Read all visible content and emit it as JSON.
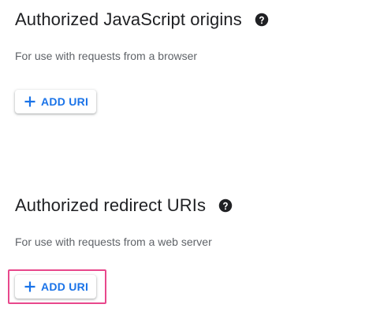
{
  "js_origins": {
    "title": "Authorized JavaScript origins",
    "help_icon": "help-circle-icon",
    "description": "For use with requests from a browser",
    "add_button_label": "ADD URI",
    "add_icon": "plus-icon"
  },
  "redirect_uris": {
    "title": "Authorized redirect URIs",
    "help_icon": "help-circle-icon",
    "description": "For use with requests from a web server",
    "add_button_label": "ADD URI",
    "add_icon": "plus-icon",
    "highlighted": true
  },
  "colors": {
    "accent": "#1a73e8",
    "heading": "#202124",
    "secondary_text": "#5f6368",
    "highlight_border": "#e8488c"
  }
}
